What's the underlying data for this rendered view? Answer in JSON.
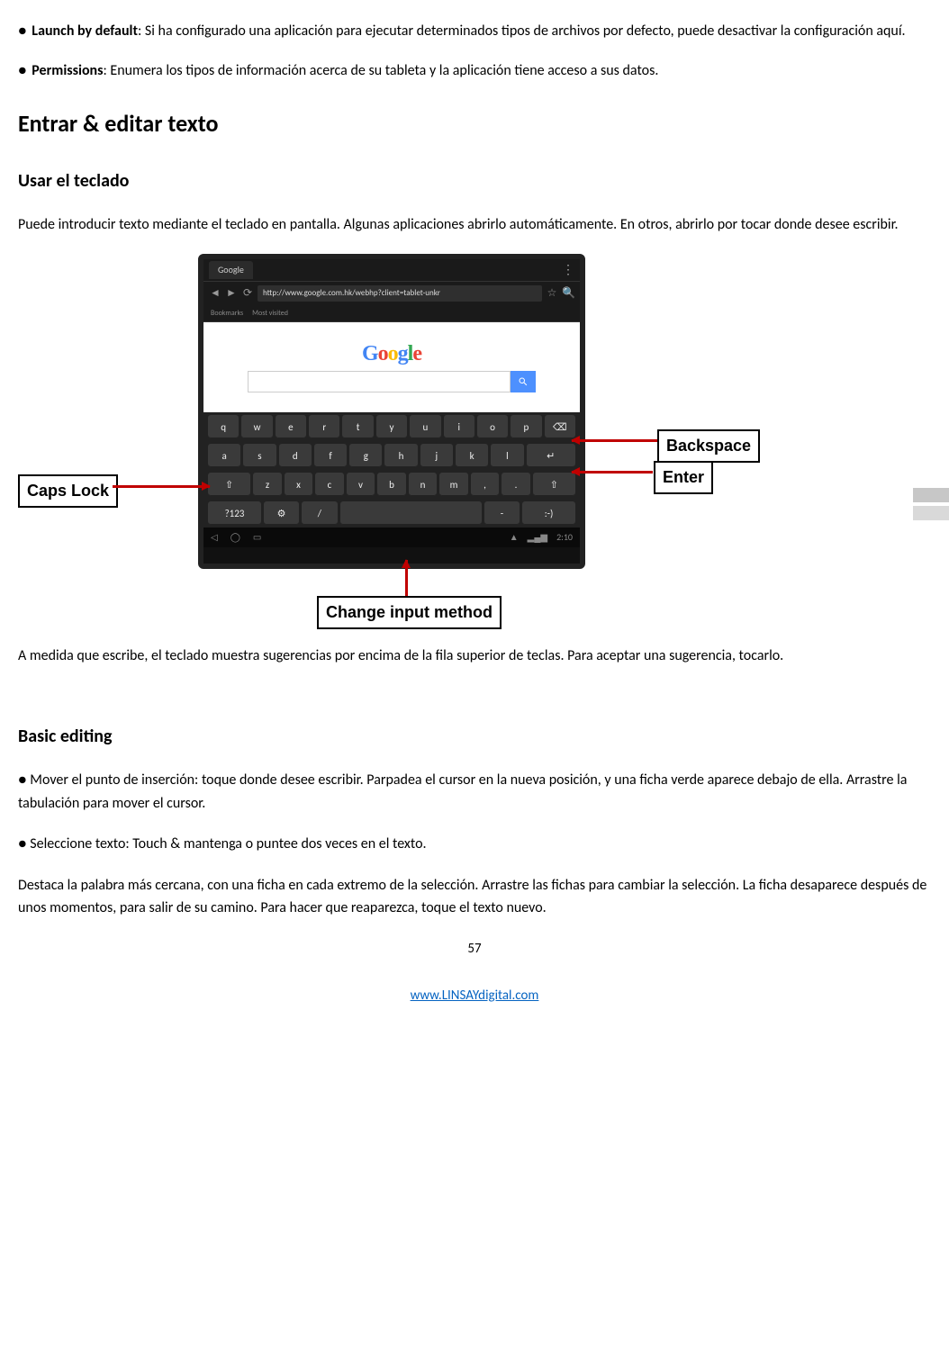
{
  "bullets": {
    "launch_label": "Launch by default",
    "launch_text": ": Si ha configurado una aplicación para ejecutar determinados tipos de archivos por defecto, puede desactivar la configuración aquí.",
    "permissions_label": "Permissions",
    "permissions_text": ": Enumera los tipos de información acerca de su tableta y la aplicación tiene acceso a sus datos."
  },
  "headings": {
    "enter_edit": "Entrar & editar texto",
    "use_keyboard": "Usar el teclado",
    "basic_editing": "Basic editing"
  },
  "paragraphs": {
    "intro_keyboard": "Puede introducir texto mediante el teclado en pantalla. Algunas aplicaciones abrirlo automáticamente. En otros, abrirlo por tocar donde desee escribir.",
    "suggestions": "A medida que escribe, el teclado muestra sugerencias por encima de la fila superior de teclas. Para aceptar una sugerencia, tocarlo.",
    "move_cursor": "● Mover el punto de inserción: toque donde desee escribir. Parpadea el cursor en la nueva posición, y una ficha verde aparece debajo de ella. Arrastre la tabulación para mover el cursor.",
    "select_text": "● Seleccione texto: Touch & mantenga o puntee dos veces en el texto.",
    "highlight": "Destaca la palabra más cercana, con una ficha en cada extremo de la selección. Arrastre las fichas para cambiar la selección. La ficha desaparece después de unos momentos, para salir de su camino. Para hacer que reaparezca, toque el texto nuevo."
  },
  "figure": {
    "tab_label": "Google",
    "url": "http://www.google.com.hk/webhp?client=tablet-unkr",
    "logo": "Google",
    "favs": [
      "Bookmarks",
      "Most visited"
    ],
    "keys_row1": [
      "q",
      "w",
      "e",
      "r",
      "t",
      "y",
      "u",
      "i",
      "o",
      "p"
    ],
    "keys_row2": [
      "a",
      "s",
      "d",
      "f",
      "g",
      "h",
      "j",
      "k",
      "l"
    ],
    "keys_row3": [
      "z",
      "x",
      "c",
      "v",
      "b",
      "n",
      "m"
    ],
    "key_123": "?123",
    "status_time": "2:10",
    "callouts": {
      "caps": "Caps Lock",
      "backspace": "Backspace",
      "enter": "Enter",
      "change": "Change input method"
    }
  },
  "footer": {
    "page_number": "57",
    "link_text": "www.LINSAYdigital.com"
  }
}
